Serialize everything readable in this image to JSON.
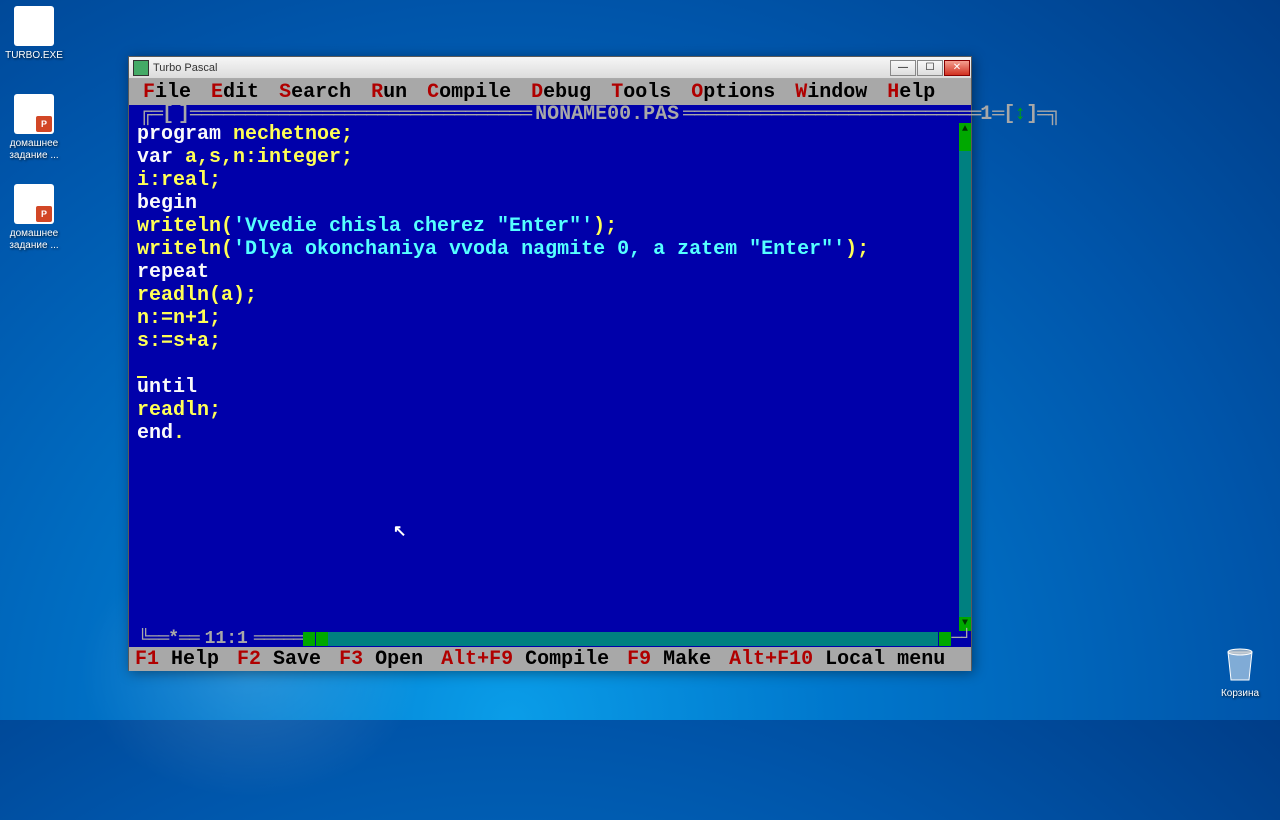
{
  "desktop": {
    "icons": {
      "turbo": "TURBO.EXE",
      "hw1": "домашнее задание ...",
      "hw2": "домашнее задание ...",
      "trash": "Корзина"
    }
  },
  "window": {
    "title": "Turbo Pascal"
  },
  "menu": {
    "file": {
      "hk": "F",
      "rest": "ile"
    },
    "edit": {
      "hk": "E",
      "rest": "dit"
    },
    "search": {
      "hk": "S",
      "rest": "earch"
    },
    "run": {
      "hk": "R",
      "rest": "un"
    },
    "compile": {
      "hk": "C",
      "rest": "ompile"
    },
    "debug": {
      "hk": "D",
      "rest": "ebug"
    },
    "tools": {
      "hk": "T",
      "rest": "ools"
    },
    "options": {
      "hk": "O",
      "rest": "ptions"
    },
    "window_m": {
      "hk": "W",
      "rest": "indow"
    },
    "help": {
      "hk": "H",
      "rest": "elp"
    }
  },
  "editor": {
    "filename": "NONAME00.PAS",
    "window_num": "1",
    "cursor_pos": "11:1",
    "code": {
      "l1_kw": "program ",
      "l1_id": "nechetnoe",
      "l1_s": ";",
      "l2_kw": "var ",
      "l2_id": "a,s,n:integer",
      "l2_s": ";",
      "l3_id": "i:real",
      "l3_s": ";",
      "l4_kw": "begin",
      "l5_id": "writeln(",
      "l5_str": "'Vvedie chisla cherez \"Enter\"'",
      "l5_s": ");",
      "l6_id": "writeln(",
      "l6_str": "'Dlya okonchaniya vvoda nagmite 0, a zatem \"Enter\"'",
      "l6_s": ");",
      "l7_kw": "repeat",
      "l8_id": "readln(a)",
      "l8_s": ";",
      "l9_id": "n:=n+1",
      "l9_s": ";",
      "l10_id": "s:=s+a",
      "l10_s": ";",
      "l12_kw": "until",
      "l13_id": "readln",
      "l13_s": ";",
      "l14_kw": "end",
      "l14_s": "."
    }
  },
  "status": {
    "f1": {
      "k": "F1",
      "l": " Help"
    },
    "f2": {
      "k": "F2",
      "l": " Save"
    },
    "f3": {
      "k": "F3",
      "l": " Open"
    },
    "altf9": {
      "k": "Alt+F9",
      "l": " Compile"
    },
    "f9": {
      "k": "F9",
      "l": " Make"
    },
    "altf10": {
      "k": "Alt+F10",
      "l": " Local menu"
    }
  }
}
